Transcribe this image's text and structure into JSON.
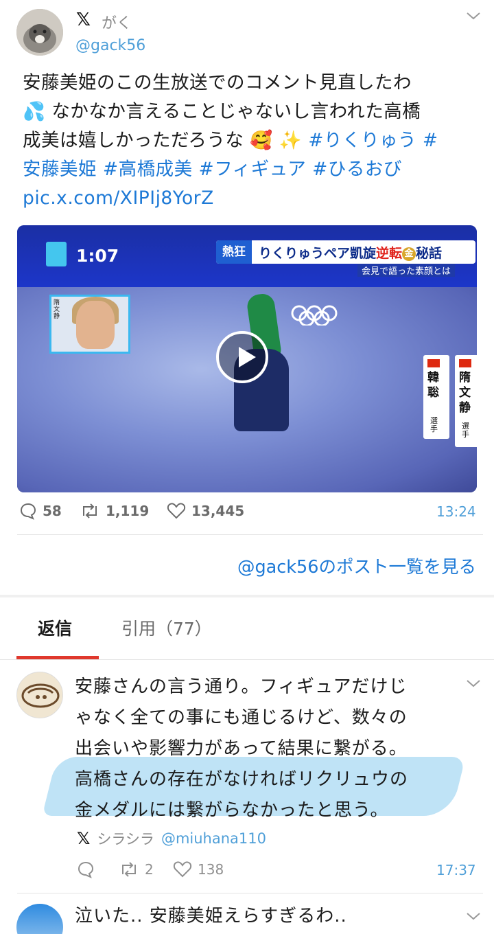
{
  "post": {
    "display_name": "がく",
    "handle": "@gack56",
    "text_plain_1": "安藤美姫のこの生放送でのコメント見直したわ",
    "text_plain_2": " なかなか言えることじゃないし言われた高橋",
    "text_plain_3": "成美は嬉しかっただろうな",
    "hashtags_line3": "#りくりゅう #",
    "hashtags_line4": "安藤美姫 #高橋成美 #フィギュア #ひるおび",
    "link": "pic.x.com/XIPIj8YorZ",
    "emoji_sweat": "💦",
    "emoji_heart_face": "🥰",
    "emoji_sparkles": "✨",
    "replies": "58",
    "reposts": "1,119",
    "likes": "13,445",
    "time": "13:24"
  },
  "video": {
    "clock": "1:07",
    "banner_tag": "熱狂",
    "banner_pre": "りくりゅうペア凱旋",
    "banner_red": "逆転",
    "banner_medal": "金",
    "banner_post": "秘話",
    "subtitle": "会見で語った素顔とは",
    "inset_label": "隋文静",
    "card_left_name": "韓聡",
    "card_right_name": "隋文静",
    "card_suffix": "選手"
  },
  "more_link": "@gack56のポスト一覧を見る",
  "tabs": [
    {
      "label": "返信",
      "active": true
    },
    {
      "label": "引用（77）",
      "active": false
    }
  ],
  "reply": {
    "line1": "安藤さんの言う通り。フィギュアだけじ",
    "line2": "ゃなく全ての事にも通じるけど、数々の",
    "line3": "出会いや影響力があって結果に繋がる。",
    "line4": "高橋さんの存在がなければリクリュウの",
    "line5": "金メダルには繋がらなかったと思う。",
    "display_name": "シラシラ",
    "handle": "@miuhana110",
    "replies": "",
    "reposts": "2",
    "likes": "138",
    "time": "17:37"
  },
  "third": {
    "text": "泣いた.. 安藤美姫えらすぎるわ.."
  },
  "colors": {
    "link_blue": "#1d79d6",
    "meta_blue": "#4f9fd8",
    "tab_underline": "#e0382d",
    "highlight": "#bfe3f6"
  }
}
